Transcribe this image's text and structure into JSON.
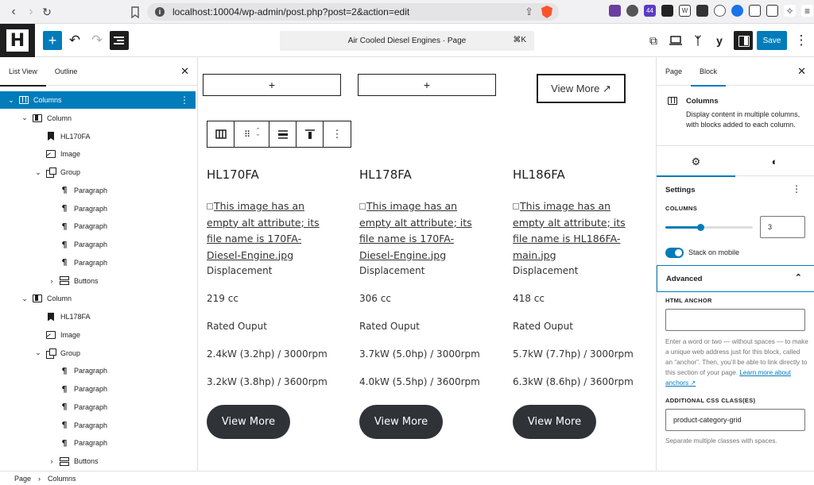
{
  "browser": {
    "url": "localhost:10004/wp-admin/post.php?post=2&action=edit",
    "ext_badge": "44"
  },
  "toolbar": {
    "add_label": "+",
    "document_title": "Air Cooled Diesel Engines · Page",
    "shortcut": "⌘K",
    "save_label": "Save"
  },
  "list_view": {
    "tabs": [
      "List View",
      "Outline"
    ],
    "rows": [
      {
        "label": "Columns",
        "icon": "columns-icon",
        "indent": 0,
        "expand": "v",
        "selected": true
      },
      {
        "label": "Column",
        "icon": "column-icon",
        "indent": 1,
        "expand": "v"
      },
      {
        "label": "HL170FA",
        "icon": "bookmark-icon",
        "indent": 2,
        "expand": ""
      },
      {
        "label": "Image",
        "icon": "image-icon",
        "indent": 2,
        "expand": ""
      },
      {
        "label": "Group",
        "icon": "group-icon",
        "indent": 2,
        "expand": "v"
      },
      {
        "label": "Paragraph",
        "icon": "paragraph-icon",
        "indent": 3,
        "expand": ""
      },
      {
        "label": "Paragraph",
        "icon": "paragraph-icon",
        "indent": 3,
        "expand": ""
      },
      {
        "label": "Paragraph",
        "icon": "paragraph-icon",
        "indent": 3,
        "expand": ""
      },
      {
        "label": "Paragraph",
        "icon": "paragraph-icon",
        "indent": 3,
        "expand": ""
      },
      {
        "label": "Paragraph",
        "icon": "paragraph-icon",
        "indent": 3,
        "expand": ""
      },
      {
        "label": "Buttons",
        "icon": "buttons-icon",
        "indent": 3,
        "expand": ">"
      },
      {
        "label": "Column",
        "icon": "column-icon",
        "indent": 1,
        "expand": "v"
      },
      {
        "label": "HL178FA",
        "icon": "bookmark-icon",
        "indent": 2,
        "expand": ""
      },
      {
        "label": "Image",
        "icon": "image-icon",
        "indent": 2,
        "expand": ""
      },
      {
        "label": "Group",
        "icon": "group-icon",
        "indent": 2,
        "expand": "v"
      },
      {
        "label": "Paragraph",
        "icon": "paragraph-icon",
        "indent": 3,
        "expand": ""
      },
      {
        "label": "Paragraph",
        "icon": "paragraph-icon",
        "indent": 3,
        "expand": ""
      },
      {
        "label": "Paragraph",
        "icon": "paragraph-icon",
        "indent": 3,
        "expand": ""
      },
      {
        "label": "Paragraph",
        "icon": "paragraph-icon",
        "indent": 3,
        "expand": ""
      },
      {
        "label": "Paragraph",
        "icon": "paragraph-icon",
        "indent": 3,
        "expand": ""
      },
      {
        "label": "Buttons",
        "icon": "buttons-icon",
        "indent": 3,
        "expand": ">"
      }
    ]
  },
  "canvas": {
    "placeholder_plus": "+",
    "view_more_outline": "View More ↗",
    "columns": [
      {
        "title": "HL170FA",
        "alt_text": "This image has an empty alt attribute; its file name is 170FA-Diesel-Engine.jpg",
        "specs": [
          "Displacement",
          "219 cc",
          "Rated Ouput",
          "2.4kW (3.2hp) / 3000rpm",
          "3.2kW (3.8hp) / 3600rpm"
        ],
        "button": "View More"
      },
      {
        "title": "HL178FA",
        "alt_text": "This image has an empty alt attribute; its file name is 170FA-Diesel-Engine.jpg",
        "specs": [
          "Displacement",
          "306 cc",
          "Rated Ouput",
          "3.7kW (5.0hp) / 3000rpm",
          "4.0kW (5.5hp) / 3600rpm"
        ],
        "button": "View More"
      },
      {
        "title": "HL186FA",
        "alt_text": "This image has an empty alt attribute; its file name is HL186FA-main.jpg",
        "specs": [
          "Displacement",
          "418 cc",
          "Rated Ouput",
          "5.7kW (7.7hp) / 3000rpm",
          "6.3kW (8.6hp) / 3600rpm"
        ],
        "button": "View More"
      }
    ]
  },
  "inspector": {
    "tabs": [
      "Page",
      "Block"
    ],
    "active_tab": "Block",
    "block_name": "Columns",
    "block_desc": "Display content in multiple columns, with blocks added to each column.",
    "settings_title": "Settings",
    "columns_label": "COLUMNS",
    "columns_value": "3",
    "columns_slider_fraction": 0.4,
    "stack_label": "Stack on mobile",
    "stack_on": true,
    "advanced_title": "Advanced",
    "anchor_label": "HTML ANCHOR",
    "anchor_value": "",
    "anchor_help": "Enter a word or two — without spaces — to make a unique web address just for this block, called an “anchor”. Then, you’ll be able to link directly to this section of your page.",
    "anchor_link": "Learn more about anchors ↗",
    "css_label": "ADDITIONAL CSS CLASS(ES)",
    "css_value": "product-category-grid",
    "css_help": "Separate multiple classes with spaces."
  },
  "breadcrumb": [
    "Page",
    "›",
    "Columns"
  ],
  "colors": {
    "accent": "#007cba",
    "dark": "#1e1e1e",
    "pill": "#2f3338"
  }
}
